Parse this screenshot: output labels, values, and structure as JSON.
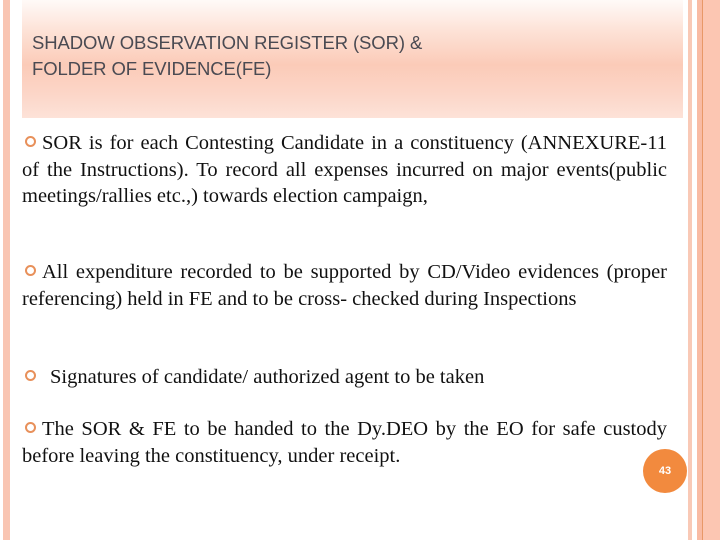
{
  "slide": {
    "title_line1": "SHADOW OBSERVATION REGISTER (SOR) &",
    "title_line2": "FOLDER OF EVIDENCE(FE)",
    "bullets": [
      {
        "icon": "hollow-circle-bullet",
        "text": "SOR is for each Contesting Candidate in a constituency (ANNEXURE-11 of the Instructions). To record all expenses incurred on major events(public meetings/rallies etc.,) towards election campaign,"
      },
      {
        "icon": "hollow-circle-bullet",
        "text": "All expenditure recorded to be supported by CD/Video evidences (proper referencing) held in FE and to be cross- checked during Inspections"
      },
      {
        "icon": "hollow-circle-bullet",
        "text": "Signatures of candidate/ authorized agent to be taken"
      },
      {
        "icon": "hollow-circle-bullet",
        "text": "The SOR & FE to be handed to the Dy.DEO by the EO for safe custody before leaving the constituency, under receipt."
      }
    ],
    "page_number": "43"
  },
  "colors": {
    "accent_orange": "#f28a3e",
    "bullet_ring": "#e8905a",
    "border_peach": "#f9c5b2",
    "title_text": "#4a4a52"
  }
}
